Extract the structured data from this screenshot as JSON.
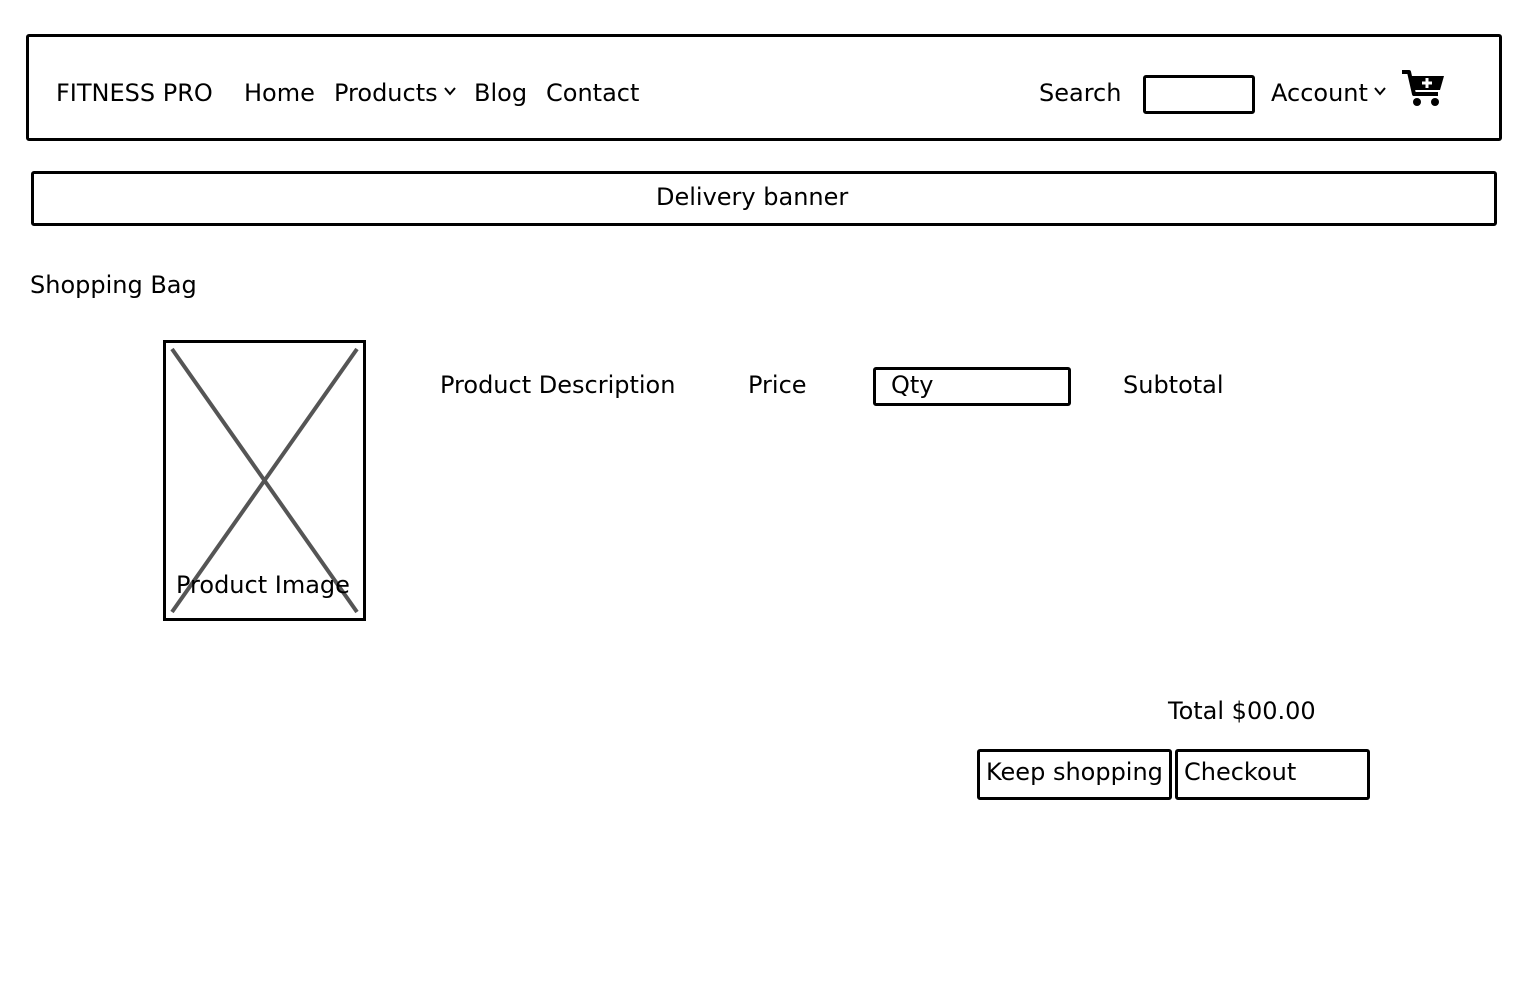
{
  "header": {
    "brand": "FITNESS PRO",
    "nav": {
      "home": "Home",
      "products": "Products",
      "blog": "Blog",
      "contact": "Contact"
    },
    "search_label": "Search",
    "search_value": "",
    "account_label": "Account",
    "cart_icon": "cart-add-icon",
    "dropdown_icon": "chevron-down-icon"
  },
  "banner": {
    "text": "Delivery banner"
  },
  "bag": {
    "title": "Shopping Bag",
    "image_placeholder": "Product Image",
    "columns": {
      "description": "Product Description",
      "price": "Price",
      "qty": "Qty",
      "subtotal": "Subtotal"
    },
    "total": "Total $00.00",
    "keep_shopping": "Keep shopping",
    "checkout": "Checkout"
  }
}
